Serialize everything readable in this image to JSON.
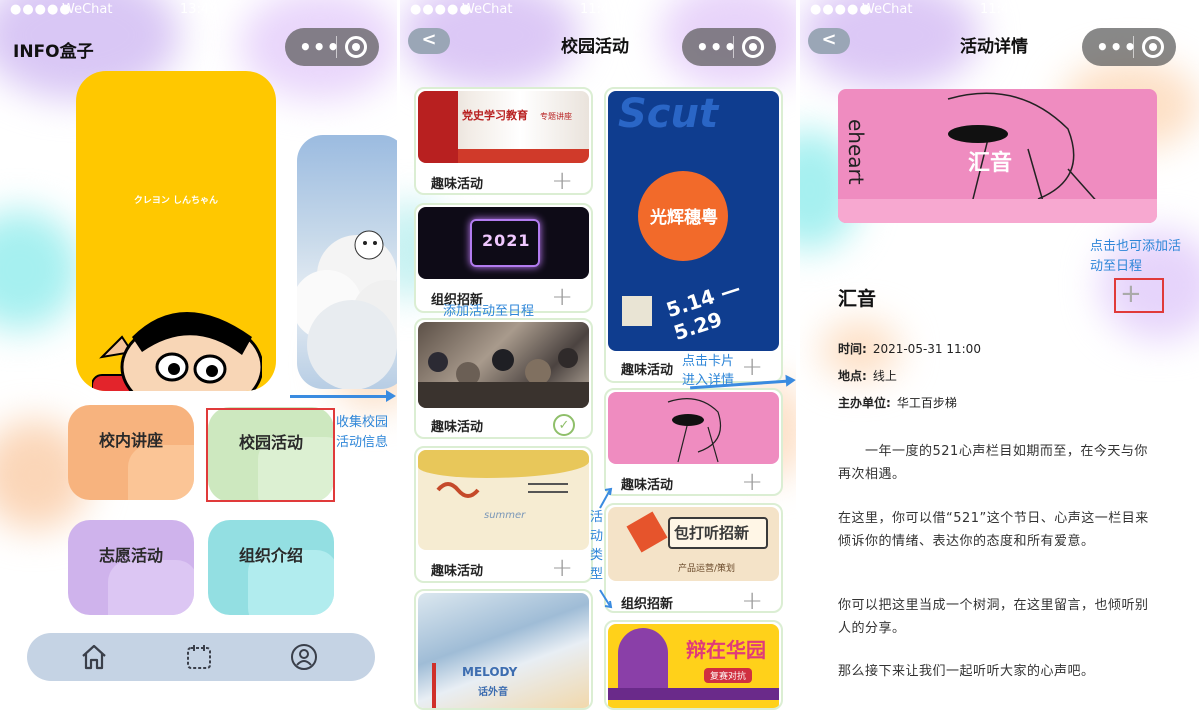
{
  "status_bar": {
    "carrier": "WeChat",
    "signal": "●●●●●",
    "screen1_time": "13:49",
    "screen2_time": "11:49",
    "screen3_time": "11:49"
  },
  "capsule": {
    "more_icon": "more-dots-icon",
    "close_icon": "target-circle-icon"
  },
  "screen1": {
    "title": "INFO盒子",
    "feature_card_caption": "クレヨン しんちゃん",
    "tiles": [
      "校内讲座",
      "校园活动",
      "志愿活动",
      "组织介绍"
    ],
    "tabbar": {
      "icons": [
        "home-icon",
        "calendar-icon",
        "profile-icon"
      ]
    },
    "annotation": "收集校园活动信息",
    "colors": {
      "tile1": "#f7b37e",
      "tile2": "#cde8bf",
      "tile3": "#cfb3ec",
      "tile4": "#93dfe2",
      "feature": "#ffc800",
      "highlight": "#e03a3a",
      "annotation": "#2e86d8"
    }
  },
  "screen2": {
    "back_label": "<",
    "title": "校园活动",
    "left_cards": [
      {
        "label": "趣味活动",
        "action": "plus"
      },
      {
        "label": "组织招新",
        "action": "plus"
      },
      {
        "label": "趣味活动",
        "action": "check"
      },
      {
        "label": "趣味活动",
        "action": "plus"
      }
    ],
    "right_cards": [
      {
        "label": "趣味活动",
        "action": "plus"
      },
      {
        "label": "趣味活动",
        "action": "plus"
      },
      {
        "label": "组织招新",
        "action": "plus"
      }
    ],
    "poster_text": {
      "banner1": "党史学习教育",
      "banner1_sub": "专题讲座",
      "neon": "2021",
      "sing": "光辉穗粤",
      "scut": "Scut",
      "dates": "5.14 —5.29",
      "recruit": "包打听招新",
      "recruit_sub": "产品运营/策划",
      "debate": "辩在华园",
      "debate_sub": "复赛对抗",
      "melody": "MELODY",
      "melody_sub": "话外音",
      "summer": "summer"
    },
    "annotations": {
      "add_schedule": "添加活动至日程",
      "tap_card": "点击卡片进入详情",
      "type": "活动类型"
    }
  },
  "screen3": {
    "back_label": "<",
    "title": "活动详情",
    "event_title": "汇音",
    "banner_text": "汇音",
    "banner_side": "eheart",
    "annotation": "点击也可添加活动至日程",
    "fields": [
      {
        "label": "时间:",
        "value": "2021-05-31 11:00"
      },
      {
        "label": "地点:",
        "value": "线上"
      },
      {
        "label": "主办单位:",
        "value": "华工百步梯"
      }
    ],
    "paragraphs": [
      "　　一年一度的521心声栏目如期而至，在今天与你再次相遇。",
      "在这里，你可以借“521”这个节日、心声这一栏目来倾诉你的情绪、表达你的态度和所有爱意。",
      "你可以把这里当成一个树洞，在这里留言，也倾听别人的分享。",
      "那么接下来让我们一起听听大家的心声吧。"
    ]
  }
}
